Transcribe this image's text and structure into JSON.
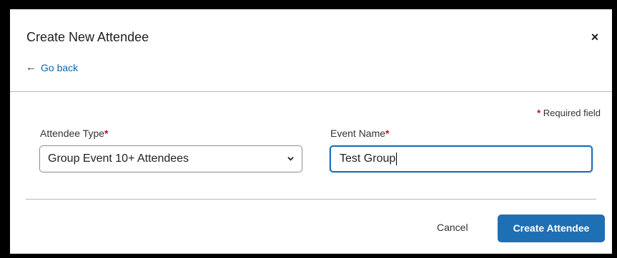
{
  "dialog": {
    "title": "Create New Attendee",
    "close_label": "×",
    "go_back_arrow": "←",
    "go_back_label": "Go back",
    "required_star": "*",
    "required_note": "Required field"
  },
  "form": {
    "attendee_type": {
      "label": "Attendee Type",
      "required_mark": "*",
      "selected": "Group Event 10+ Attendees"
    },
    "event_name": {
      "label": "Event Name",
      "required_mark": "*",
      "value": "Test Group"
    }
  },
  "footer": {
    "cancel_label": "Cancel",
    "create_label": "Create Attendee"
  },
  "colors": {
    "primary": "#1f6fb4",
    "link": "#0a6aa8",
    "required": "#d0021b"
  },
  "icons": {
    "close": "close-icon",
    "back": "arrow-left-icon",
    "dropdown": "chevron-down-icon"
  }
}
